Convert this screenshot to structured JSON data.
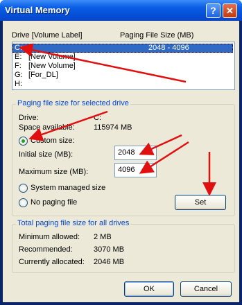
{
  "window": {
    "title": "Virtual Memory",
    "help_glyph": "?",
    "close_glyph": "✕"
  },
  "drive_list": {
    "header_drive": "Drive  [Volume Label]",
    "header_paging": "Paging File Size (MB)",
    "rows": [
      {
        "drive": "C:",
        "label": "",
        "size": "2048 - 4096",
        "selected": true
      },
      {
        "drive": "E:",
        "label": "[New Volume]",
        "size": ""
      },
      {
        "drive": "F:",
        "label": "[New Volume]",
        "size": ""
      },
      {
        "drive": "G:",
        "label": "[For_DL]",
        "size": ""
      },
      {
        "drive": "H:",
        "label": "",
        "size": ""
      }
    ]
  },
  "selected_group": {
    "title": "Paging file size for selected drive",
    "drive_label": "Drive:",
    "drive_value": "C:",
    "space_label": "Space available:",
    "space_value": "115974 MB",
    "custom_size": "Custom size:",
    "initial_label": "Initial size (MB):",
    "initial_value": "2048",
    "maximum_label": "Maximum size (MB):",
    "maximum_value": "4096",
    "system_managed": "System managed size",
    "no_paging": "No paging file",
    "set_button": "Set"
  },
  "total_group": {
    "title": "Total paging file size for all drives",
    "min_label": "Minimum allowed:",
    "min_value": "2 MB",
    "rec_label": "Recommended:",
    "rec_value": "3070 MB",
    "cur_label": "Currently allocated:",
    "cur_value": "2046 MB"
  },
  "buttons": {
    "ok": "OK",
    "cancel": "Cancel"
  },
  "colors": {
    "annotation_arrow": "#e01010",
    "selection": "#316ac5",
    "group_title": "#0046d5"
  }
}
